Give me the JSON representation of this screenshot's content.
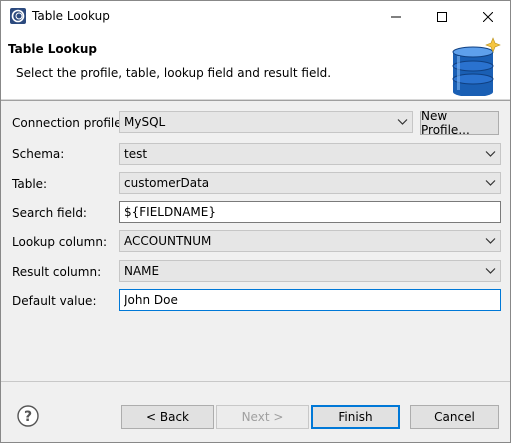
{
  "window": {
    "title": "Table Lookup",
    "icon": "eclipse-app-icon"
  },
  "header": {
    "title": "Table Lookup",
    "description": "Select the profile, table, lookup field and result field.",
    "icon": "database-icon"
  },
  "form": {
    "connection_profile": {
      "label": "Connection profile:",
      "value": "MySQL"
    },
    "new_profile_button": "New Profile...",
    "schema": {
      "label": "Schema:",
      "value": "test"
    },
    "table": {
      "label": "Table:",
      "value": "customerData"
    },
    "search_field": {
      "label": "Search field:",
      "value": "${FIELDNAME}"
    },
    "lookup_column": {
      "label": "Lookup column:",
      "value": "ACCOUNTNUM"
    },
    "result_column": {
      "label": "Result column:",
      "value": "NAME"
    },
    "default_value": {
      "label": "Default value:",
      "value": "John Doe"
    }
  },
  "footer": {
    "back": "< Back",
    "next": "Next >",
    "finish": "Finish",
    "cancel": "Cancel",
    "help_icon": "help-icon"
  },
  "colors": {
    "accent": "#0078d7",
    "db_blue": "#1a5fb4",
    "db_star": "#f5c542"
  }
}
